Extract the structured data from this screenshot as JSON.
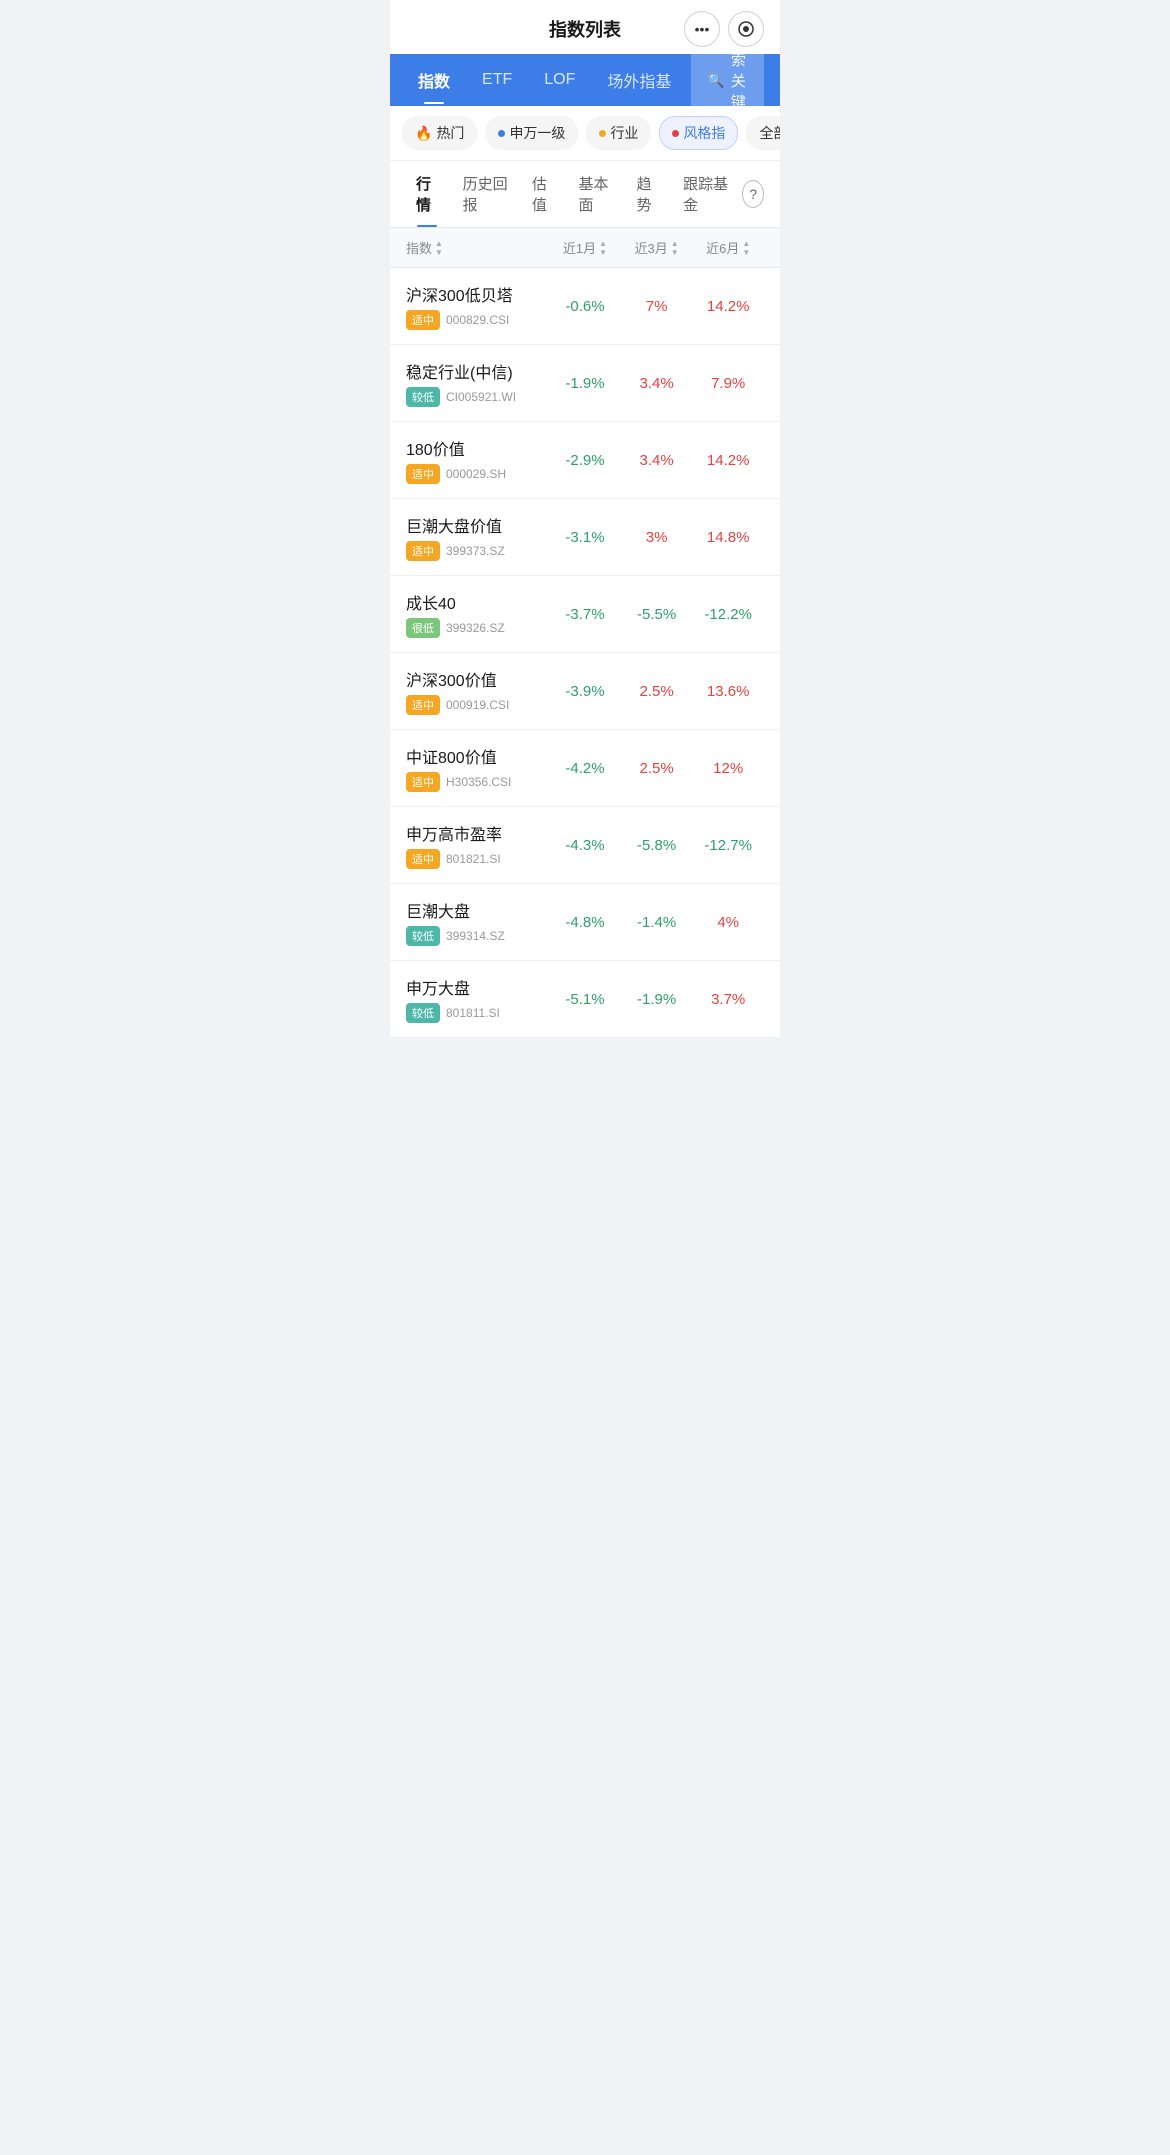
{
  "header": {
    "title": "指数列表",
    "more_label": "•••",
    "record_label": "⊙"
  },
  "tabs": [
    {
      "id": "index",
      "label": "指数",
      "active": true
    },
    {
      "id": "etf",
      "label": "ETF",
      "active": false
    },
    {
      "id": "lof",
      "label": "LOF",
      "active": false
    },
    {
      "id": "offmarket",
      "label": "场外指基",
      "active": false
    }
  ],
  "search": {
    "placeholder": "搜索关键词"
  },
  "filters": [
    {
      "id": "hot",
      "label": "热门",
      "dot_color": "#e84040",
      "type": "fire",
      "active": false
    },
    {
      "id": "sw1",
      "label": "申万一级",
      "dot_color": "#3d7de8",
      "active": false
    },
    {
      "id": "industry",
      "label": "行业",
      "dot_color": "#f5a623",
      "active": false
    },
    {
      "id": "style",
      "label": "风格指",
      "dot_color": "#e84040",
      "active": true
    },
    {
      "id": "all",
      "label": "全部指数",
      "active": false
    }
  ],
  "sub_tabs": [
    {
      "id": "market",
      "label": "行情",
      "active": true
    },
    {
      "id": "history",
      "label": "历史回报",
      "active": false
    },
    {
      "id": "valuation",
      "label": "估值",
      "active": false
    },
    {
      "id": "fundamental",
      "label": "基本面",
      "active": false
    },
    {
      "id": "trend",
      "label": "趋势",
      "active": false
    },
    {
      "id": "fund",
      "label": "跟踪基金",
      "active": false
    }
  ],
  "table": {
    "columns": [
      {
        "id": "index",
        "label": "指数",
        "sortable": true
      },
      {
        "id": "1m",
        "label": "近1月",
        "sortable": true
      },
      {
        "id": "3m",
        "label": "近3月",
        "sortable": true
      },
      {
        "id": "6m",
        "label": "近6月",
        "sortable": true
      }
    ],
    "rows": [
      {
        "name": "沪深300低贝塔",
        "risk": "适中",
        "risk_class": "risk-medium",
        "code": "000829.CSI",
        "m1": "-0.6%",
        "m1_class": "neg",
        "m3": "7%",
        "m3_class": "pos",
        "m6": "14.2%",
        "m6_class": "pos"
      },
      {
        "name": "稳定行业(中信)",
        "risk": "较低",
        "risk_class": "risk-low",
        "code": "CI005921.WI",
        "m1": "-1.9%",
        "m1_class": "neg",
        "m3": "3.4%",
        "m3_class": "pos",
        "m6": "7.9%",
        "m6_class": "pos"
      },
      {
        "name": "180价值",
        "risk": "适中",
        "risk_class": "risk-medium",
        "code": "000029.SH",
        "m1": "-2.9%",
        "m1_class": "neg",
        "m3": "3.4%",
        "m3_class": "pos",
        "m6": "14.2%",
        "m6_class": "pos"
      },
      {
        "name": "巨潮大盘价值",
        "risk": "适中",
        "risk_class": "risk-medium",
        "code": "399373.SZ",
        "m1": "-3.1%",
        "m1_class": "neg",
        "m3": "3%",
        "m3_class": "pos",
        "m6": "14.8%",
        "m6_class": "pos"
      },
      {
        "name": "成长40",
        "risk": "很低",
        "risk_class": "risk-vlow",
        "code": "399326.SZ",
        "m1": "-3.7%",
        "m1_class": "neg",
        "m3": "-5.5%",
        "m3_class": "neg",
        "m6": "-12.2%",
        "m6_class": "neg"
      },
      {
        "name": "沪深300价值",
        "risk": "适中",
        "risk_class": "risk-medium",
        "code": "000919.CSI",
        "m1": "-3.9%",
        "m1_class": "neg",
        "m3": "2.5%",
        "m3_class": "pos",
        "m6": "13.6%",
        "m6_class": "pos"
      },
      {
        "name": "中证800价值",
        "risk": "适中",
        "risk_class": "risk-medium",
        "code": "H30356.CSI",
        "m1": "-4.2%",
        "m1_class": "neg",
        "m3": "2.5%",
        "m3_class": "pos",
        "m6": "12%",
        "m6_class": "pos"
      },
      {
        "name": "申万高市盈率",
        "risk": "适中",
        "risk_class": "risk-medium",
        "code": "801821.SI",
        "m1": "-4.3%",
        "m1_class": "neg",
        "m3": "-5.8%",
        "m3_class": "neg",
        "m6": "-12.7%",
        "m6_class": "neg"
      },
      {
        "name": "巨潮大盘",
        "risk": "较低",
        "risk_class": "risk-low",
        "code": "399314.SZ",
        "m1": "-4.8%",
        "m1_class": "neg",
        "m3": "-1.4%",
        "m3_class": "neg",
        "m6": "4%",
        "m6_class": "pos"
      },
      {
        "name": "申万大盘",
        "risk": "较低",
        "risk_class": "risk-low",
        "code": "801811.SI",
        "m1": "-5.1%",
        "m1_class": "neg",
        "m3": "-1.9%",
        "m3_class": "neg",
        "m6": "3.7%",
        "m6_class": "pos"
      }
    ]
  }
}
